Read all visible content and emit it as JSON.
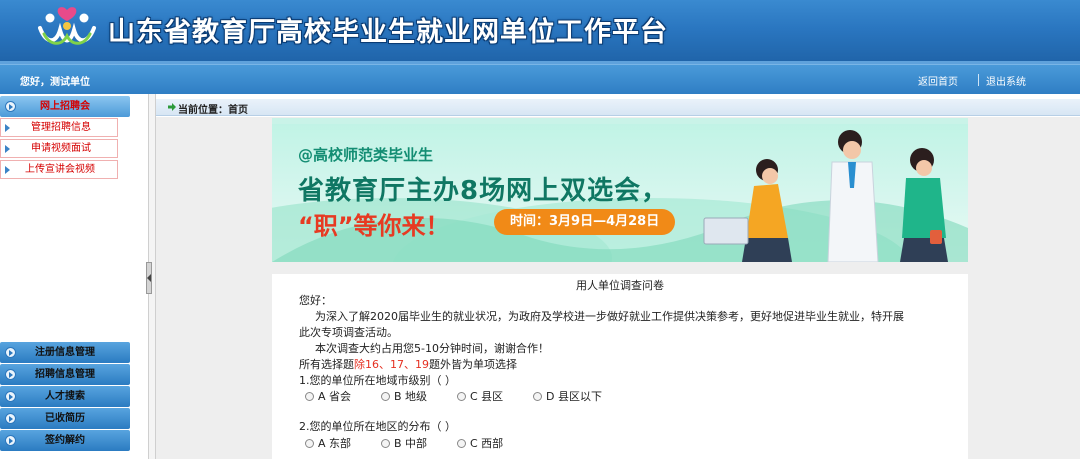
{
  "header": {
    "title": "山东省教育厅高校毕业生就业网单位工作平台",
    "logo": "three-figures-heart-logo"
  },
  "topbar": {
    "greeting": "您好，测试单位",
    "home_link": "返回首页",
    "logout_link": "退出系统"
  },
  "sidebar": {
    "active_menu": "网上招聘会",
    "submenu": [
      "管理招聘信息",
      "申请视频面试",
      "上传宣讲会视频"
    ],
    "bottom_menu": [
      "注册信息管理",
      "招聘信息管理",
      "人才搜索",
      "已收简历",
      "签约解约"
    ]
  },
  "breadcrumb": {
    "text": "当前位置：首页"
  },
  "banner": {
    "subtitle": "@高校师范类毕业生",
    "headline": "省教育厅主办8场网上双选会，",
    "slogan": "“职”等你来！",
    "date_pill": "时间：3月9日—4月28日"
  },
  "survey": {
    "title": "用人单位调查问卷",
    "greeting": "您好：",
    "intro_1": "为深入了解2020届毕业生的就业状况，为政府及学校进一步做好就业工作提供决策参考，更好地促进毕业生就业，特开展",
    "intro_2": "此次专项调查活动。",
    "time_note": "本次调查大约占用您5-10分钟时间，谢谢合作！",
    "rule_prefix": "所有选择题",
    "rule_red": "除16、17、19",
    "rule_suffix": "题外皆为单项选择",
    "q1": {
      "text": "1.您的单位所在地域市级别（   ）",
      "options": [
        "A 省会",
        "B 地级",
        "C 县区",
        "D 县区以下"
      ]
    },
    "q2": {
      "text": "2.您的单位所在地区的分布（   ）",
      "options": [
        "A 东部",
        "B 中部",
        "C 西部"
      ]
    }
  },
  "colors": {
    "header_blue": "#2a76c0",
    "menu_red": "#d50000",
    "banner_green": "#0f7763",
    "banner_orange": "#f18a17"
  }
}
